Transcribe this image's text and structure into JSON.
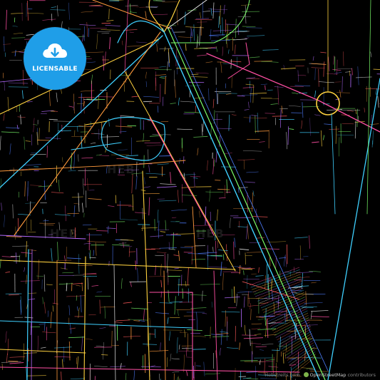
{
  "badge": {
    "label": "LICENSABLE",
    "color": "#1f9ee8",
    "icon": "cloud-download-icon"
  },
  "attribution": {
    "source": "Hebstreits.com",
    "osm_text": "OpenStreetMap",
    "contributors_text": "contributors",
    "icon": "openstreetmap-icon"
  },
  "map": {
    "background": "#000000",
    "road_colors": [
      "#ff4fa3",
      "#3fd0ff",
      "#ffd23f",
      "#ff9a3c",
      "#7cff6b",
      "#b46bff",
      "#ff5a5a",
      "#4f7dff",
      "#e6e6e6"
    ]
  }
}
